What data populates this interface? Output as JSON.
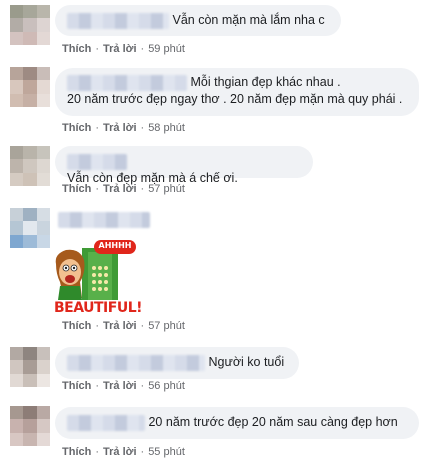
{
  "comments": [
    {
      "text": "Vẫn còn mặn mà lắm nha c",
      "like": "Thích",
      "reply": "Trả lời",
      "time": "59 phút"
    },
    {
      "text_line1": "Mỗi thgian đẹp khác nhau .",
      "text_line2": "20 năm trước đẹp ngay thơ . 20 năm đẹp mặn mà quy phái .",
      "like": "Thích",
      "reply": "Trả lời",
      "time": "58 phút"
    },
    {
      "text": "Vẫn còn đẹp mặn mà á chế ơi.",
      "like": "Thích",
      "reply": "Trả lời",
      "time": "57 phút"
    },
    {
      "sticker_word": "BEAUTIFUL!",
      "sticker_shout": "AHHHH",
      "like": "Thích",
      "reply": "Trả lời",
      "time": "57 phút"
    },
    {
      "text": "Người ko tuổi",
      "like": "Thích",
      "reply": "Trả lời",
      "time": "56 phút"
    },
    {
      "text": "20 năm trước đẹp 20 năm sau càng đẹp hơn",
      "like": "Thích",
      "reply": "Trả lời",
      "time": "55 phút"
    }
  ],
  "colors": {
    "bubble": "#f0f2f5",
    "meta_text": "#65676b",
    "sticker_red": "#e0261b",
    "sticker_green": "#2f8a2b"
  }
}
